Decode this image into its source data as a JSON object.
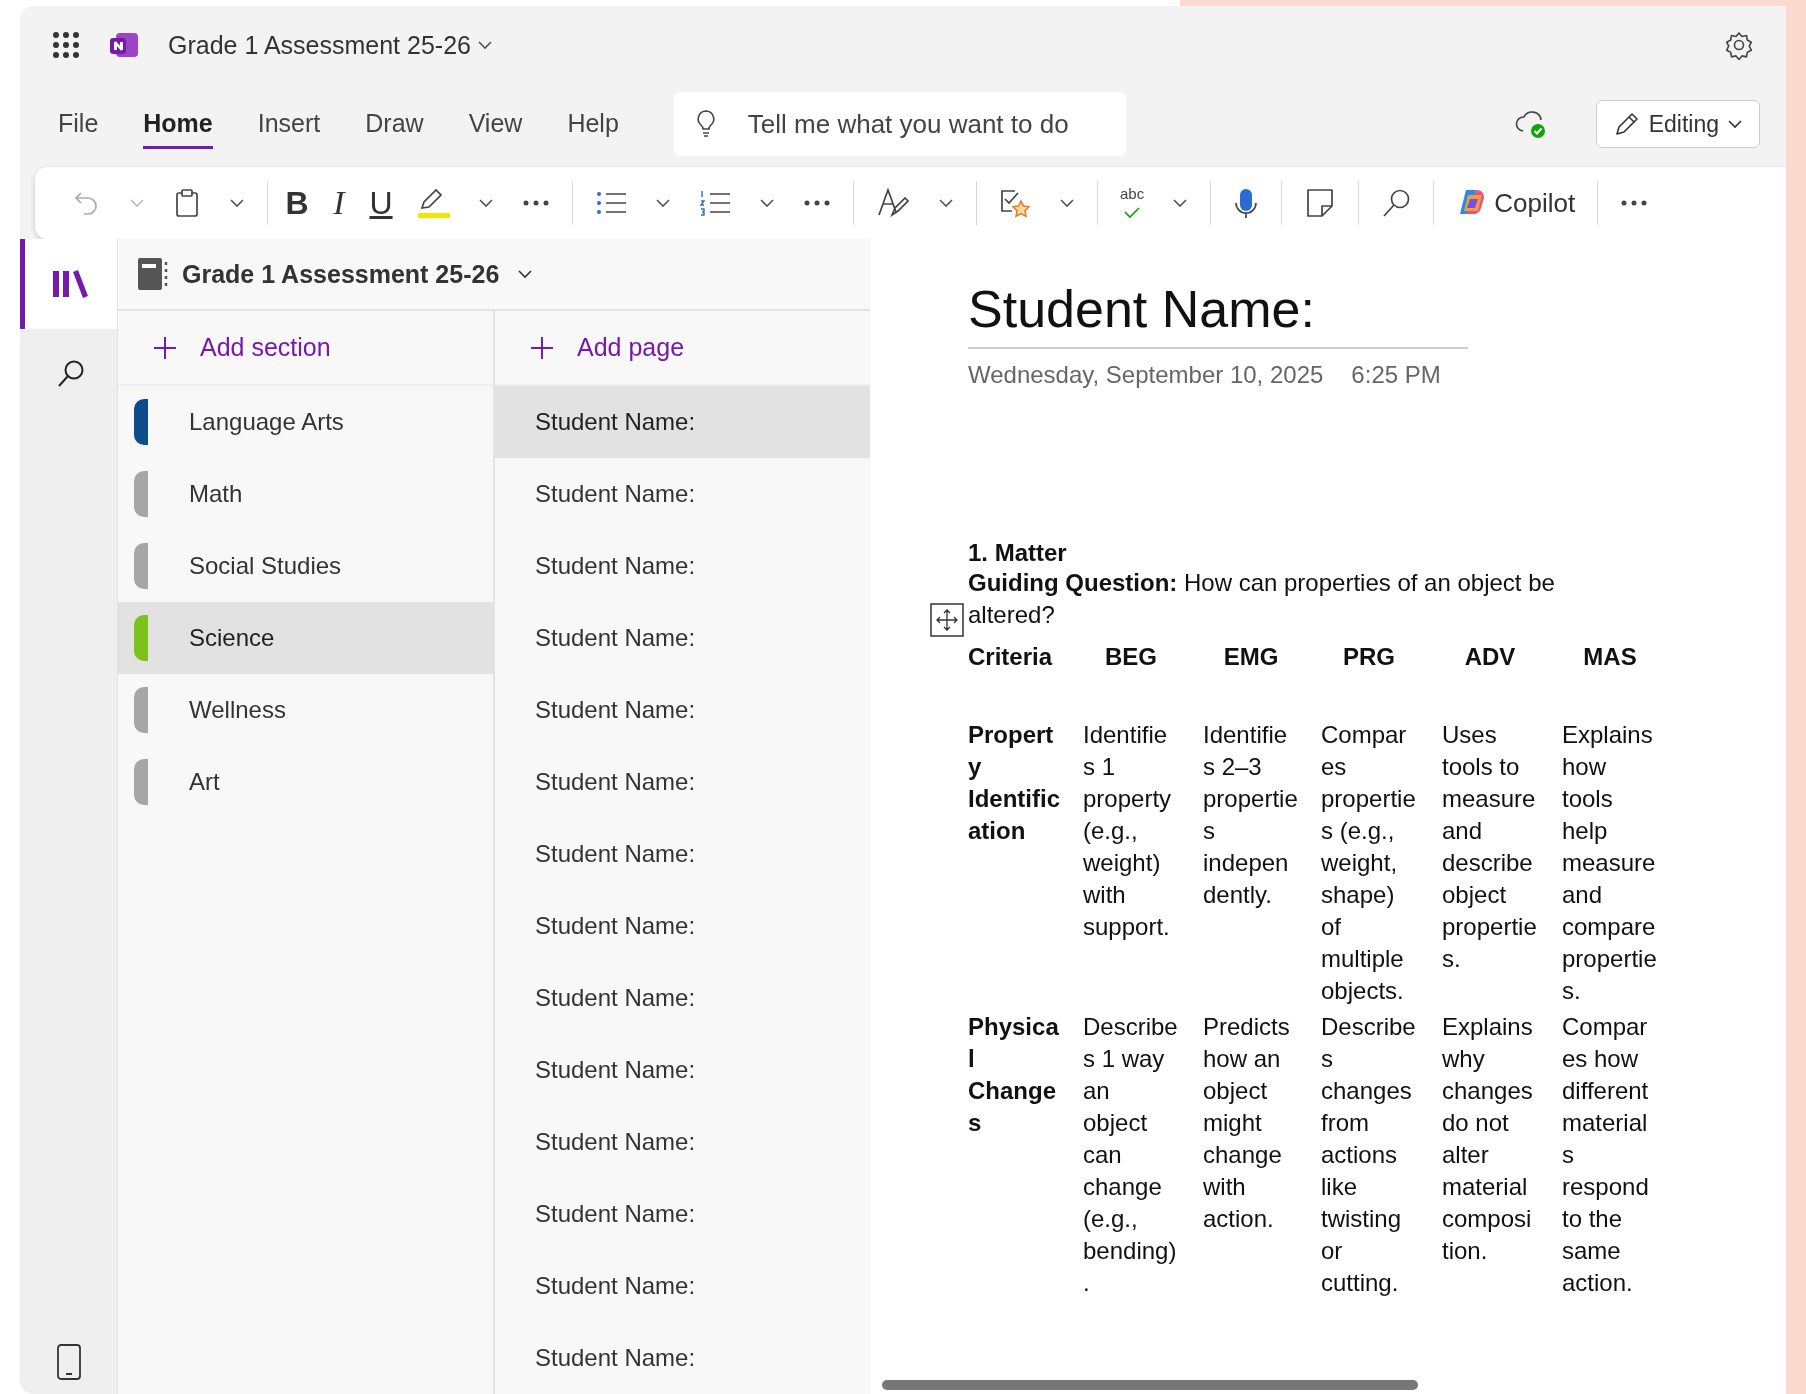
{
  "app_bar": {
    "notebook_title": "Grade 1 Assessment 25-26"
  },
  "menu_tabs": [
    {
      "label": "File",
      "selected": false
    },
    {
      "label": "Home",
      "selected": true
    },
    {
      "label": "Insert",
      "selected": false
    },
    {
      "label": "Draw",
      "selected": false
    },
    {
      "label": "View",
      "selected": false
    },
    {
      "label": "Help",
      "selected": false
    }
  ],
  "tell_me": {
    "placeholder": "Tell me what you want to do"
  },
  "mode_button": {
    "label": "Editing"
  },
  "toolbar": {
    "undo_disabled": true,
    "bold": "B",
    "italic": "I",
    "underline": "U",
    "spelling": "abc",
    "copilot": "Copilot"
  },
  "rail": [
    {
      "kind": "notebooks",
      "selected": true
    },
    {
      "kind": "search",
      "selected": false
    }
  ],
  "notebook": {
    "title": "Grade 1 Assessment 25-26"
  },
  "add_section": "Add section",
  "add_page": "Add page",
  "sections": [
    {
      "name": "Language Arts",
      "color": "#0f4c8a",
      "selected": false
    },
    {
      "name": "Math",
      "color": "#a6a6a6",
      "selected": false
    },
    {
      "name": "Social Studies",
      "color": "#a6a6a6",
      "selected": false
    },
    {
      "name": "Science",
      "color": "#7cc21b",
      "selected": true
    },
    {
      "name": "Wellness",
      "color": "#a6a6a6",
      "selected": false
    },
    {
      "name": "Art",
      "color": "#a6a6a6",
      "selected": false
    }
  ],
  "pages": [
    {
      "title": "Student Name:",
      "selected": true
    },
    {
      "title": "Student Name:",
      "selected": false
    },
    {
      "title": "Student Name:",
      "selected": false
    },
    {
      "title": "Student Name:",
      "selected": false
    },
    {
      "title": "Student Name:",
      "selected": false
    },
    {
      "title": "Student Name:",
      "selected": false
    },
    {
      "title": "Student Name:",
      "selected": false
    },
    {
      "title": "Student Name:",
      "selected": false
    },
    {
      "title": "Student Name:",
      "selected": false
    },
    {
      "title": "Student Name:",
      "selected": false
    },
    {
      "title": "Student Name:",
      "selected": false
    },
    {
      "title": "Student Name:",
      "selected": false
    },
    {
      "title": "Student Name:",
      "selected": false
    },
    {
      "title": "Student Name:",
      "selected": false
    }
  ],
  "page": {
    "title": "Student Name:",
    "date": "Wednesday, September 10, 2025",
    "time": "6:25 PM",
    "heading": "1. Matter",
    "guiding_question": "**Guiding Question:** How can properties of an object be altered?",
    "rubric": {
      "columns": [
        "Criteria",
        "BEG",
        "EMG",
        "PRG",
        "ADV",
        "MAS"
      ],
      "rows": [
        {
          "cells": [
            "Property Identification",
            "Identifies 1 property (e.g., weight) with support.",
            "Identifies 2–3 properties independently.",
            "Compares properties (e.g., weight, shape) of multiple objects.",
            "Uses tools to measure and describe object properties.",
            "Explains how tools help measure and compare properties."
          ]
        },
        {
          "cells": [
            "Physical Changes",
            "Describes 1 way an object can change (e.g., bending).",
            "Predicts how an object might change with action.",
            "Describes changes from actions like twisting or cutting.",
            "Explains why changes do not alter material composition.",
            "Compares how different materials respond to the same action."
          ]
        }
      ]
    }
  }
}
